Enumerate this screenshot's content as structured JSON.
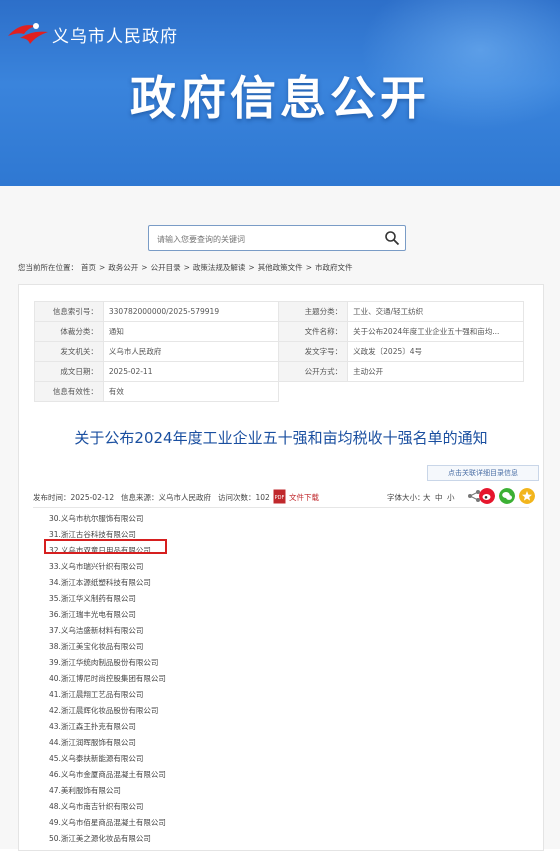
{
  "header": {
    "site_name": "义乌市人民政府",
    "banner_title": "政府信息公开"
  },
  "search": {
    "placeholder": "请输入您要查询的关键词"
  },
  "breadcrumb": {
    "label": "您当前所在位置：",
    "items": [
      "首页",
      "政务公开",
      "公开目录",
      "政策法规及解读",
      "其他政策文件",
      "市政府文件"
    ],
    "separator": ">"
  },
  "meta": {
    "rows": [
      {
        "k1": "信息索引号：",
        "v1": "330782000000/2025-579919",
        "k2": "主题分类：",
        "v2": "工业、交通/轻工纺织"
      },
      {
        "k1": "体裁分类：",
        "v1": "通知",
        "k2": "文件名称：",
        "v2": "关于公布2024年度工业企业五十强和亩均..."
      },
      {
        "k1": "发文机关：",
        "v1": "义乌市人民政府",
        "k2": "发文字号：",
        "v2": "义政发〔2025〕4号"
      },
      {
        "k1": "成文日期：",
        "v1": "2025-02-11",
        "k2": "公开方式：",
        "v2": "主动公开"
      },
      {
        "k1": "信息有效性：",
        "v1": "有效",
        "k2": "",
        "v2": ""
      }
    ]
  },
  "document": {
    "title": "关于公布2024年度工业企业五十强和亩均税收十强名单的通知",
    "catalog_button": "点击关联详细目录信息"
  },
  "pubbar": {
    "publish_time": "发布时间：2025-02-12",
    "source": "信息来源：义乌市人民政府",
    "visits": "访问次数：102",
    "download": "文件下载",
    "font_size_label": "字体大小：",
    "font_large": "大",
    "font_medium": "中",
    "font_small": "小"
  },
  "companies": [
    "30.义乌市杭尔服饰有限公司",
    "31.浙江古谷科技有限公司",
    "32.义乌市双童日用品有限公司",
    "33.义乌市瑞兴针织有限公司",
    "34.浙江本源纸塑科技有限公司",
    "35.浙江华义制药有限公司",
    "36.浙江瑞丰光电有限公司",
    "37.义乌洁盛新材料有限公司",
    "38.浙江美宝化妆品有限公司",
    "39.浙江华统肉制品股份有限公司",
    "40.浙江博尼时尚控股集团有限公司",
    "41.浙江晨翔工艺品有限公司",
    "42.浙江晨辉化妆品股份有限公司",
    "43.浙江森王扑克有限公司",
    "44.浙江润晖服饰有限公司",
    "45.义乌泰扶新能源有限公司",
    "46.义乌市金厦商品混凝土有限公司",
    "47.美利服饰有限公司",
    "48.义乌市南吉针织有限公司",
    "49.义乌市佰星商品混凝土有限公司",
    "50.浙江美之源化妆品有限公司"
  ],
  "highlighted_index": 2,
  "colors": {
    "header_blue": "#2f78d2",
    "title_blue": "#1a4fa0",
    "highlight_red": "#d61f1f"
  }
}
